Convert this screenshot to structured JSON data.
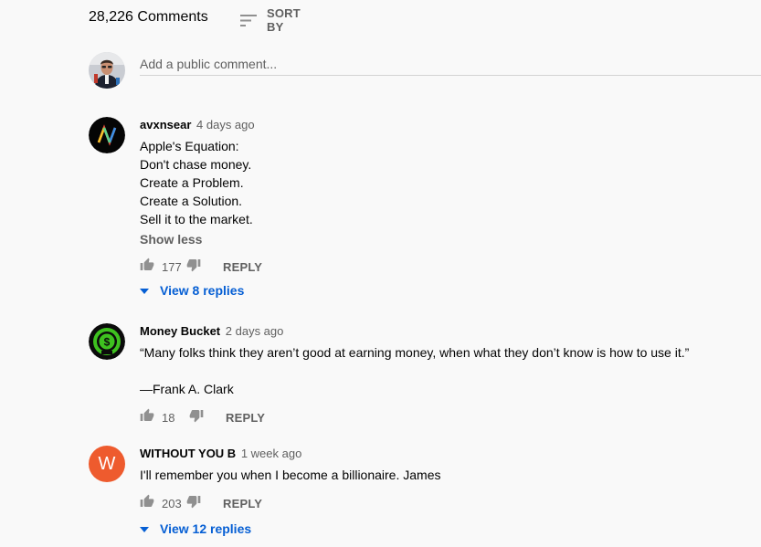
{
  "header": {
    "comment_count": "28,226 Comments",
    "sort_label": "SORT BY",
    "sort_icon": "sort-lines-icon"
  },
  "add_comment": {
    "placeholder": "Add a public comment..."
  },
  "colors": {
    "link_blue": "#065fd4",
    "secondary_text": "#606060",
    "background": "#f9f9f9",
    "avatar_w_orange": "#ee5b2e",
    "avatar_money_green": "#3ec11f"
  },
  "comments": [
    {
      "author": "avxnsear",
      "time": "4 days ago",
      "text_lines": [
        "Apple's Equation:",
        "Don't chase money.",
        "Create a Problem.",
        "Create a Solution.",
        "Sell it to the market."
      ],
      "show_less": "Show less",
      "likes": "177",
      "reply_label": "REPLY",
      "view_replies": "View 8 replies"
    },
    {
      "author": "Money Bucket",
      "time": "2 days ago",
      "text_lines": [
        "“Many folks think they aren’t good at earning money, when what they don’t know is how to use it.”",
        "",
        "—Frank A. Clark"
      ],
      "likes": "18",
      "reply_label": "REPLY"
    },
    {
      "author": "WITHOUT YOU B",
      "time": "1 week ago",
      "avatar_letter": "W",
      "text_lines": [
        "I'll remember you when I become a billionaire. James"
      ],
      "likes": "203",
      "reply_label": "REPLY",
      "view_replies": "View 12 replies"
    }
  ]
}
